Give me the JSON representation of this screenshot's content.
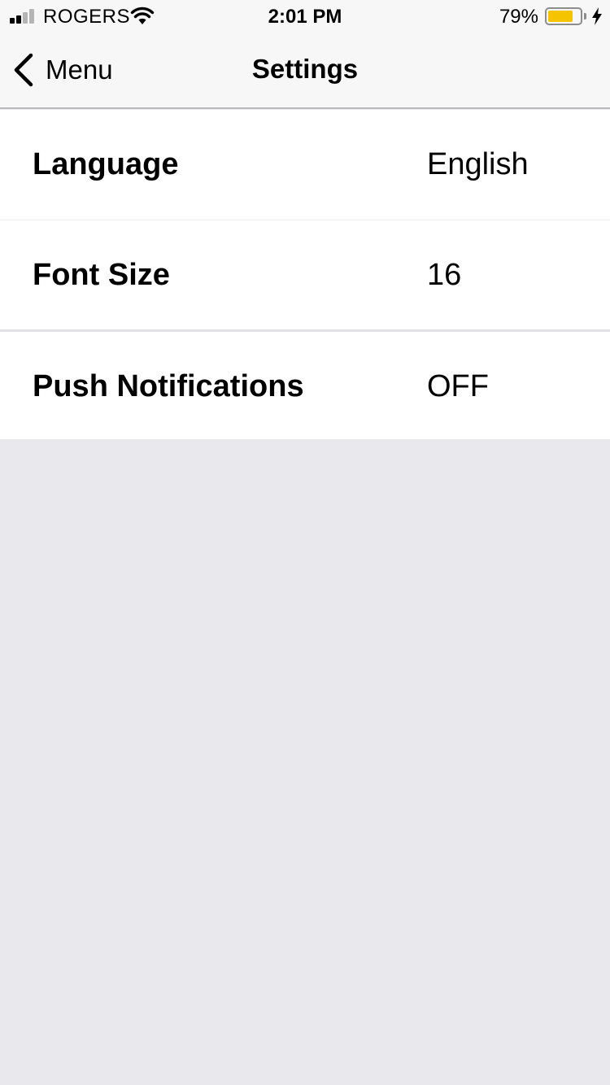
{
  "status_bar": {
    "carrier": "ROGERS",
    "time": "2:01 PM",
    "battery_percent": "79%",
    "battery_level": 0.79,
    "battery_color": "#f4c400",
    "icons": [
      "signal-icon",
      "wifi-icon",
      "battery-icon",
      "charging-bolt-icon"
    ]
  },
  "nav": {
    "back_label": "Menu",
    "title": "Settings",
    "back_icon": "chevron-left-icon"
  },
  "settings": [
    {
      "label": "Language",
      "value": "English"
    },
    {
      "label": "Font Size",
      "value": "16"
    },
    {
      "label": "Push Notifications",
      "value": "OFF"
    }
  ]
}
